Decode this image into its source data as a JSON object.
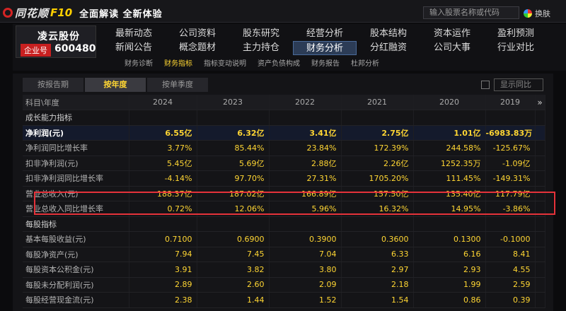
{
  "topbar": {
    "brand": "同花顺",
    "f10": "F10",
    "slogan": "全面解读 全新体验",
    "search_placeholder": "输入股票名称或代码",
    "skin_label": "换肤"
  },
  "stock": {
    "name": "凌云股份",
    "tag": "企业号",
    "code": "600480"
  },
  "nav": {
    "row1": [
      "最新动态",
      "公司资料",
      "股东研究",
      "经营分析",
      "股本结构",
      "资本运作",
      "盈利预测"
    ],
    "row2": [
      "新闻公告",
      "概念题材",
      "主力持仓",
      "财务分析",
      "分红融资",
      "公司大事",
      "行业对比"
    ],
    "active": "财务分析"
  },
  "subnav": {
    "items": [
      "财务诊断",
      "财务指标",
      "指标变动说明",
      "资产负债构成",
      "财务报告",
      "杜邦分析"
    ],
    "active": "财务指标"
  },
  "view_tabs": {
    "items": [
      "按报告期",
      "按年度",
      "按单季度"
    ],
    "active": "按年度"
  },
  "yoy_label": "显示同比",
  "table": {
    "header_label": "科目\\年度",
    "years": [
      "2024",
      "2023",
      "2022",
      "2021",
      "2020",
      "2019"
    ],
    "scroll_arrow": "»",
    "rows": [
      {
        "type": "section",
        "label": "成长能力指标"
      },
      {
        "type": "highlight",
        "label": "净利润(元)",
        "values": [
          "6.55亿",
          "6.32亿",
          "3.41亿",
          "2.75亿",
          "1.01亿",
          "-6983.83万"
        ]
      },
      {
        "label": "净利润同比增长率",
        "values": [
          "3.77%",
          "85.44%",
          "23.84%",
          "172.39%",
          "244.58%",
          "-125.67%"
        ]
      },
      {
        "label": "扣非净利润(元)",
        "values": [
          "5.45亿",
          "5.69亿",
          "2.88亿",
          "2.26亿",
          "1252.35万",
          "-1.09亿"
        ]
      },
      {
        "label": "扣非净利润同比增长率",
        "values": [
          "-4.14%",
          "97.70%",
          "27.31%",
          "1705.20%",
          "111.45%",
          "-149.31%"
        ]
      },
      {
        "label": "营业总收入(元)",
        "values": [
          "188.37亿",
          "187.02亿",
          "166.89亿",
          "157.50亿",
          "135.40亿",
          "117.79亿"
        ]
      },
      {
        "label": "营业总收入同比增长率",
        "values": [
          "0.72%",
          "12.06%",
          "5.96%",
          "16.32%",
          "14.95%",
          "-3.86%"
        ]
      },
      {
        "type": "section",
        "label": "每股指标"
      },
      {
        "label": "基本每股收益(元)",
        "values": [
          "0.7100",
          "0.6900",
          "0.3900",
          "0.3600",
          "0.1300",
          "-0.1000"
        ]
      },
      {
        "label": "每股净资产(元)",
        "values": [
          "7.94",
          "7.45",
          "7.04",
          "6.33",
          "6.16",
          "8.41"
        ]
      },
      {
        "label": "每股资本公积金(元)",
        "values": [
          "3.91",
          "3.82",
          "3.80",
          "2.97",
          "2.93",
          "4.55"
        ]
      },
      {
        "label": "每股未分配利润(元)",
        "values": [
          "2.89",
          "2.60",
          "2.09",
          "2.18",
          "1.99",
          "2.59"
        ]
      },
      {
        "label": "每股经营现金流(元)",
        "values": [
          "2.38",
          "1.44",
          "1.52",
          "1.54",
          "0.86",
          "0.39"
        ]
      }
    ]
  },
  "colors": {
    "accent_yellow": "#ffd633",
    "highlight_border": "#e5323a",
    "tag_red": "#c82020"
  }
}
